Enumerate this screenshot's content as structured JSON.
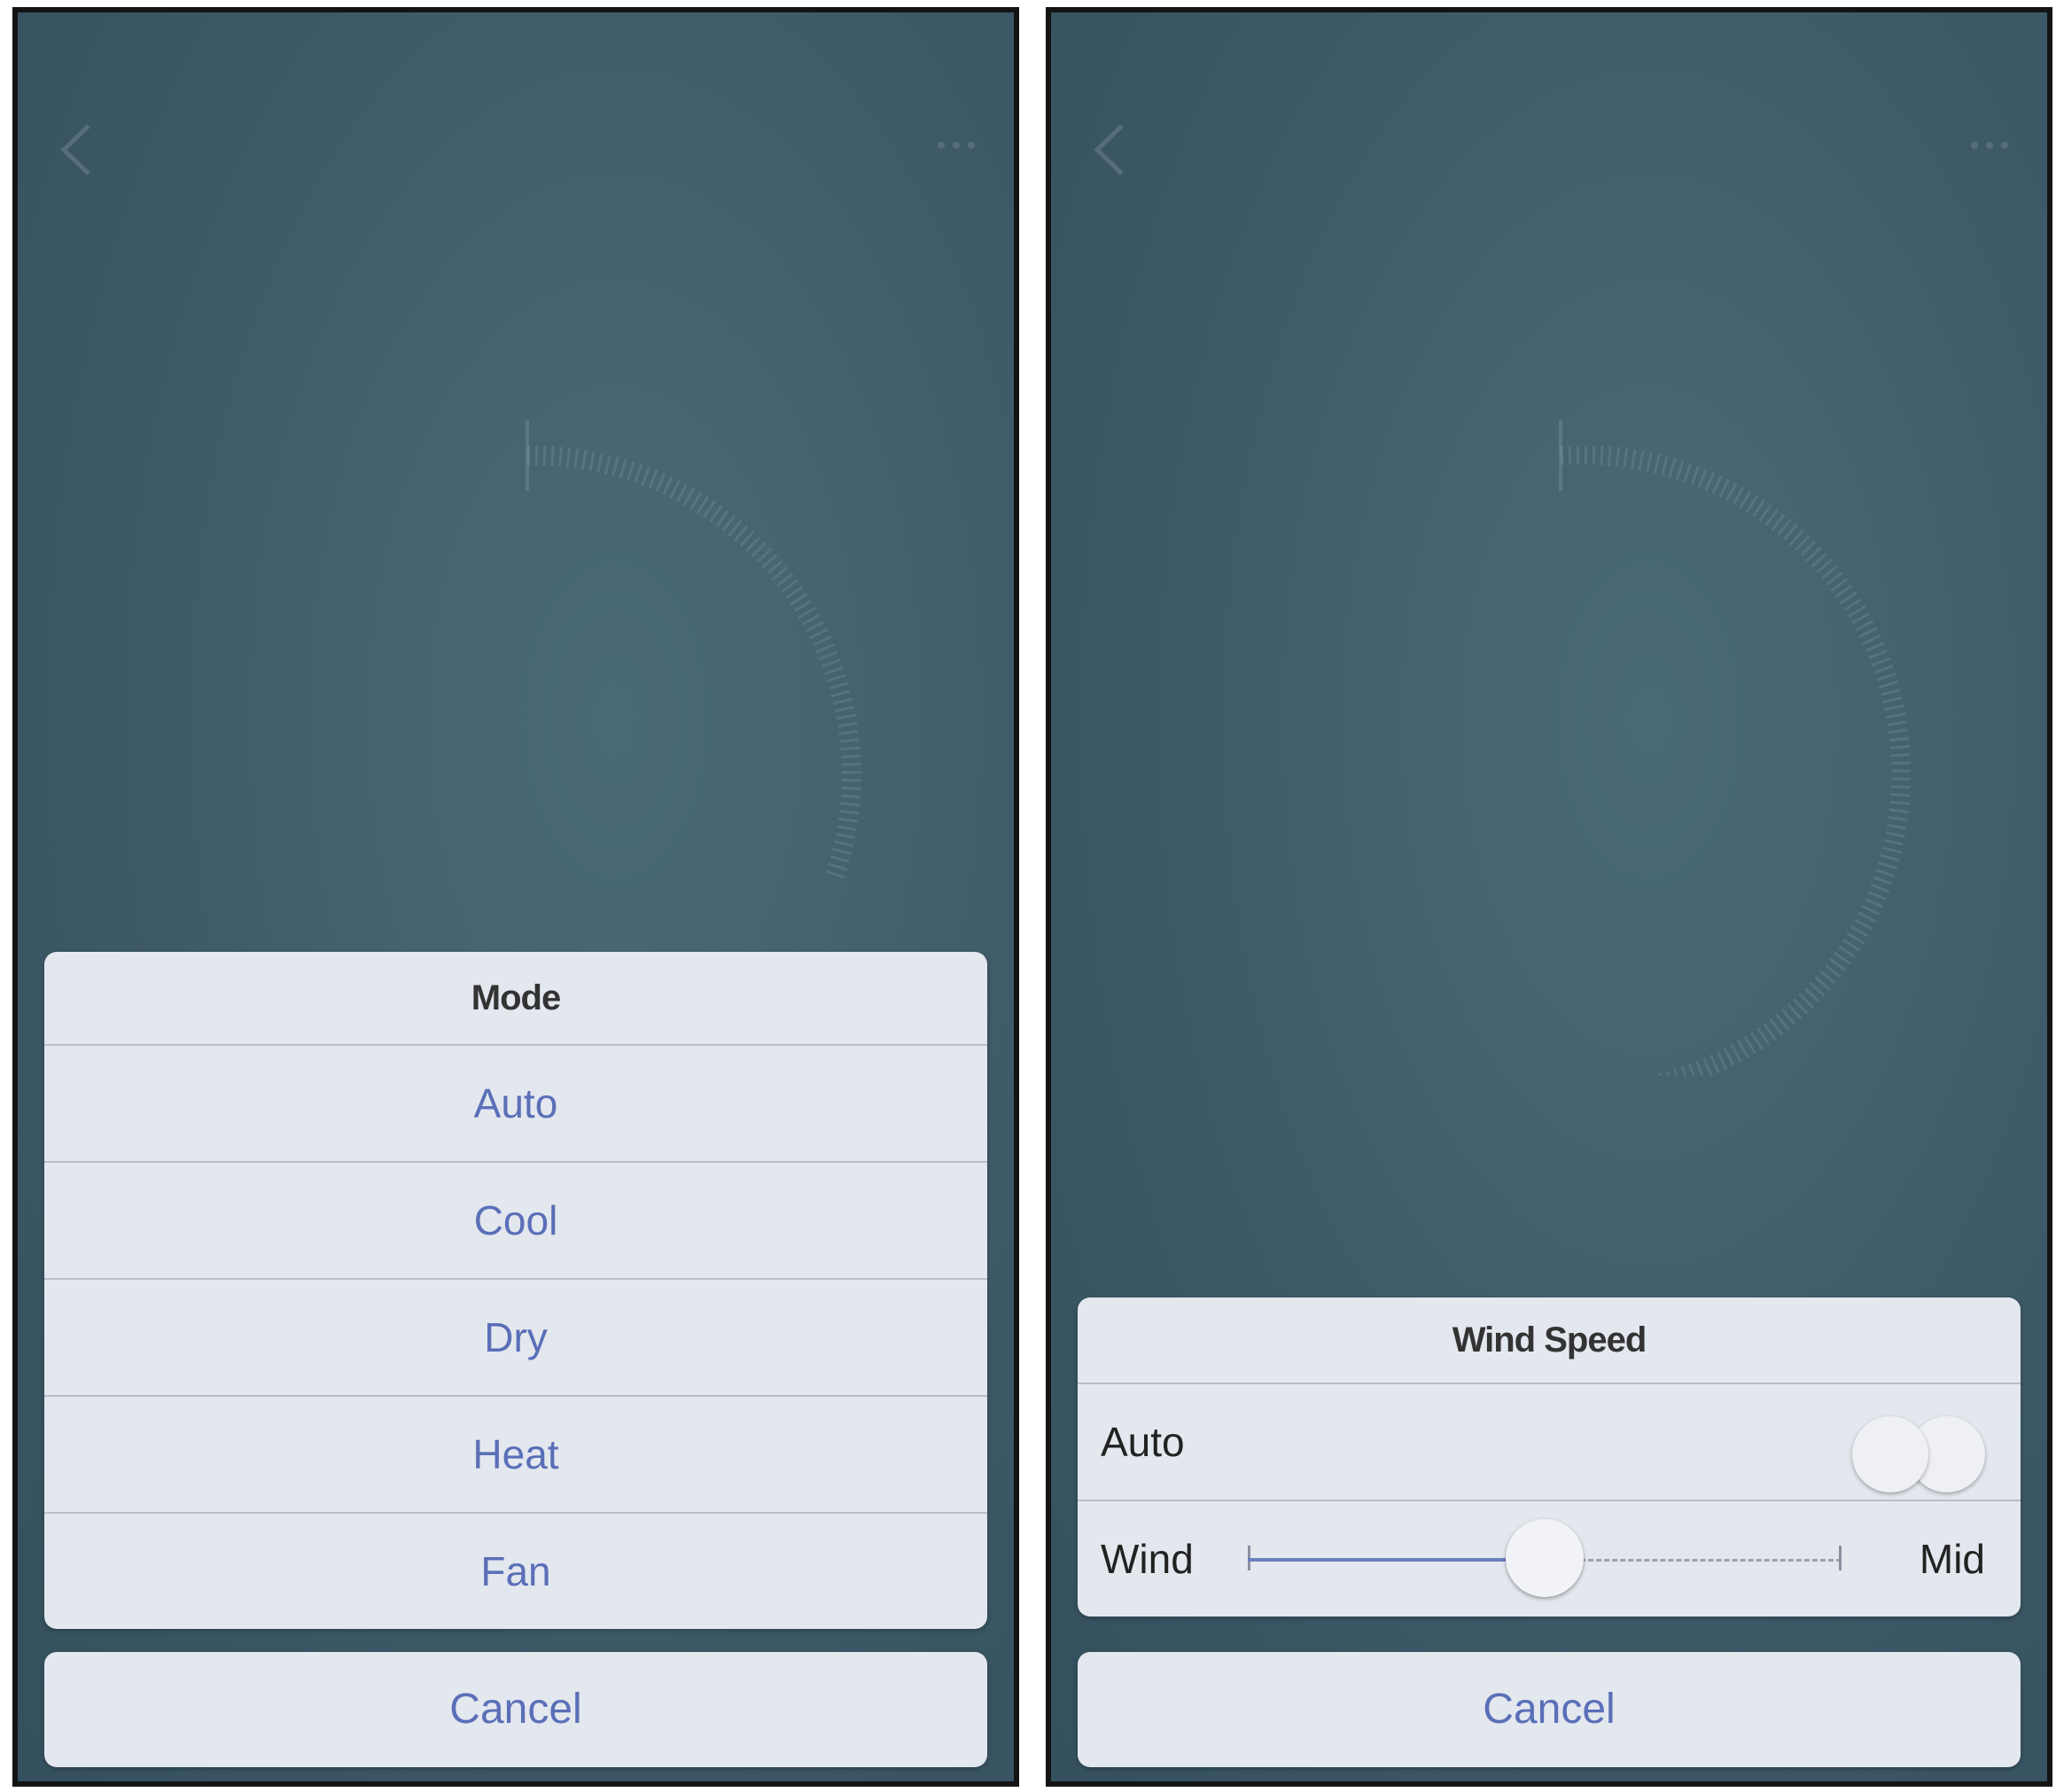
{
  "left_screen": {
    "mode_sheet": {
      "title": "Mode",
      "options": [
        "Auto",
        "Cool",
        "Dry",
        "Heat",
        "Fan"
      ],
      "cancel_label": "Cancel"
    }
  },
  "right_screen": {
    "wind_sheet": {
      "title": "Wind Speed",
      "auto_label": "Auto",
      "auto_toggle_on": false,
      "wind_label": "Wind",
      "wind_value": "Mid",
      "wind_level_fraction": 0.5,
      "cancel_label": "Cancel"
    }
  },
  "colors": {
    "accent": "#5a6fb8",
    "sheet_bg": "#e3e7ee",
    "backdrop": "#3e5a68"
  },
  "icons": {
    "back": "chevron-left-icon",
    "more": "more-icon"
  }
}
